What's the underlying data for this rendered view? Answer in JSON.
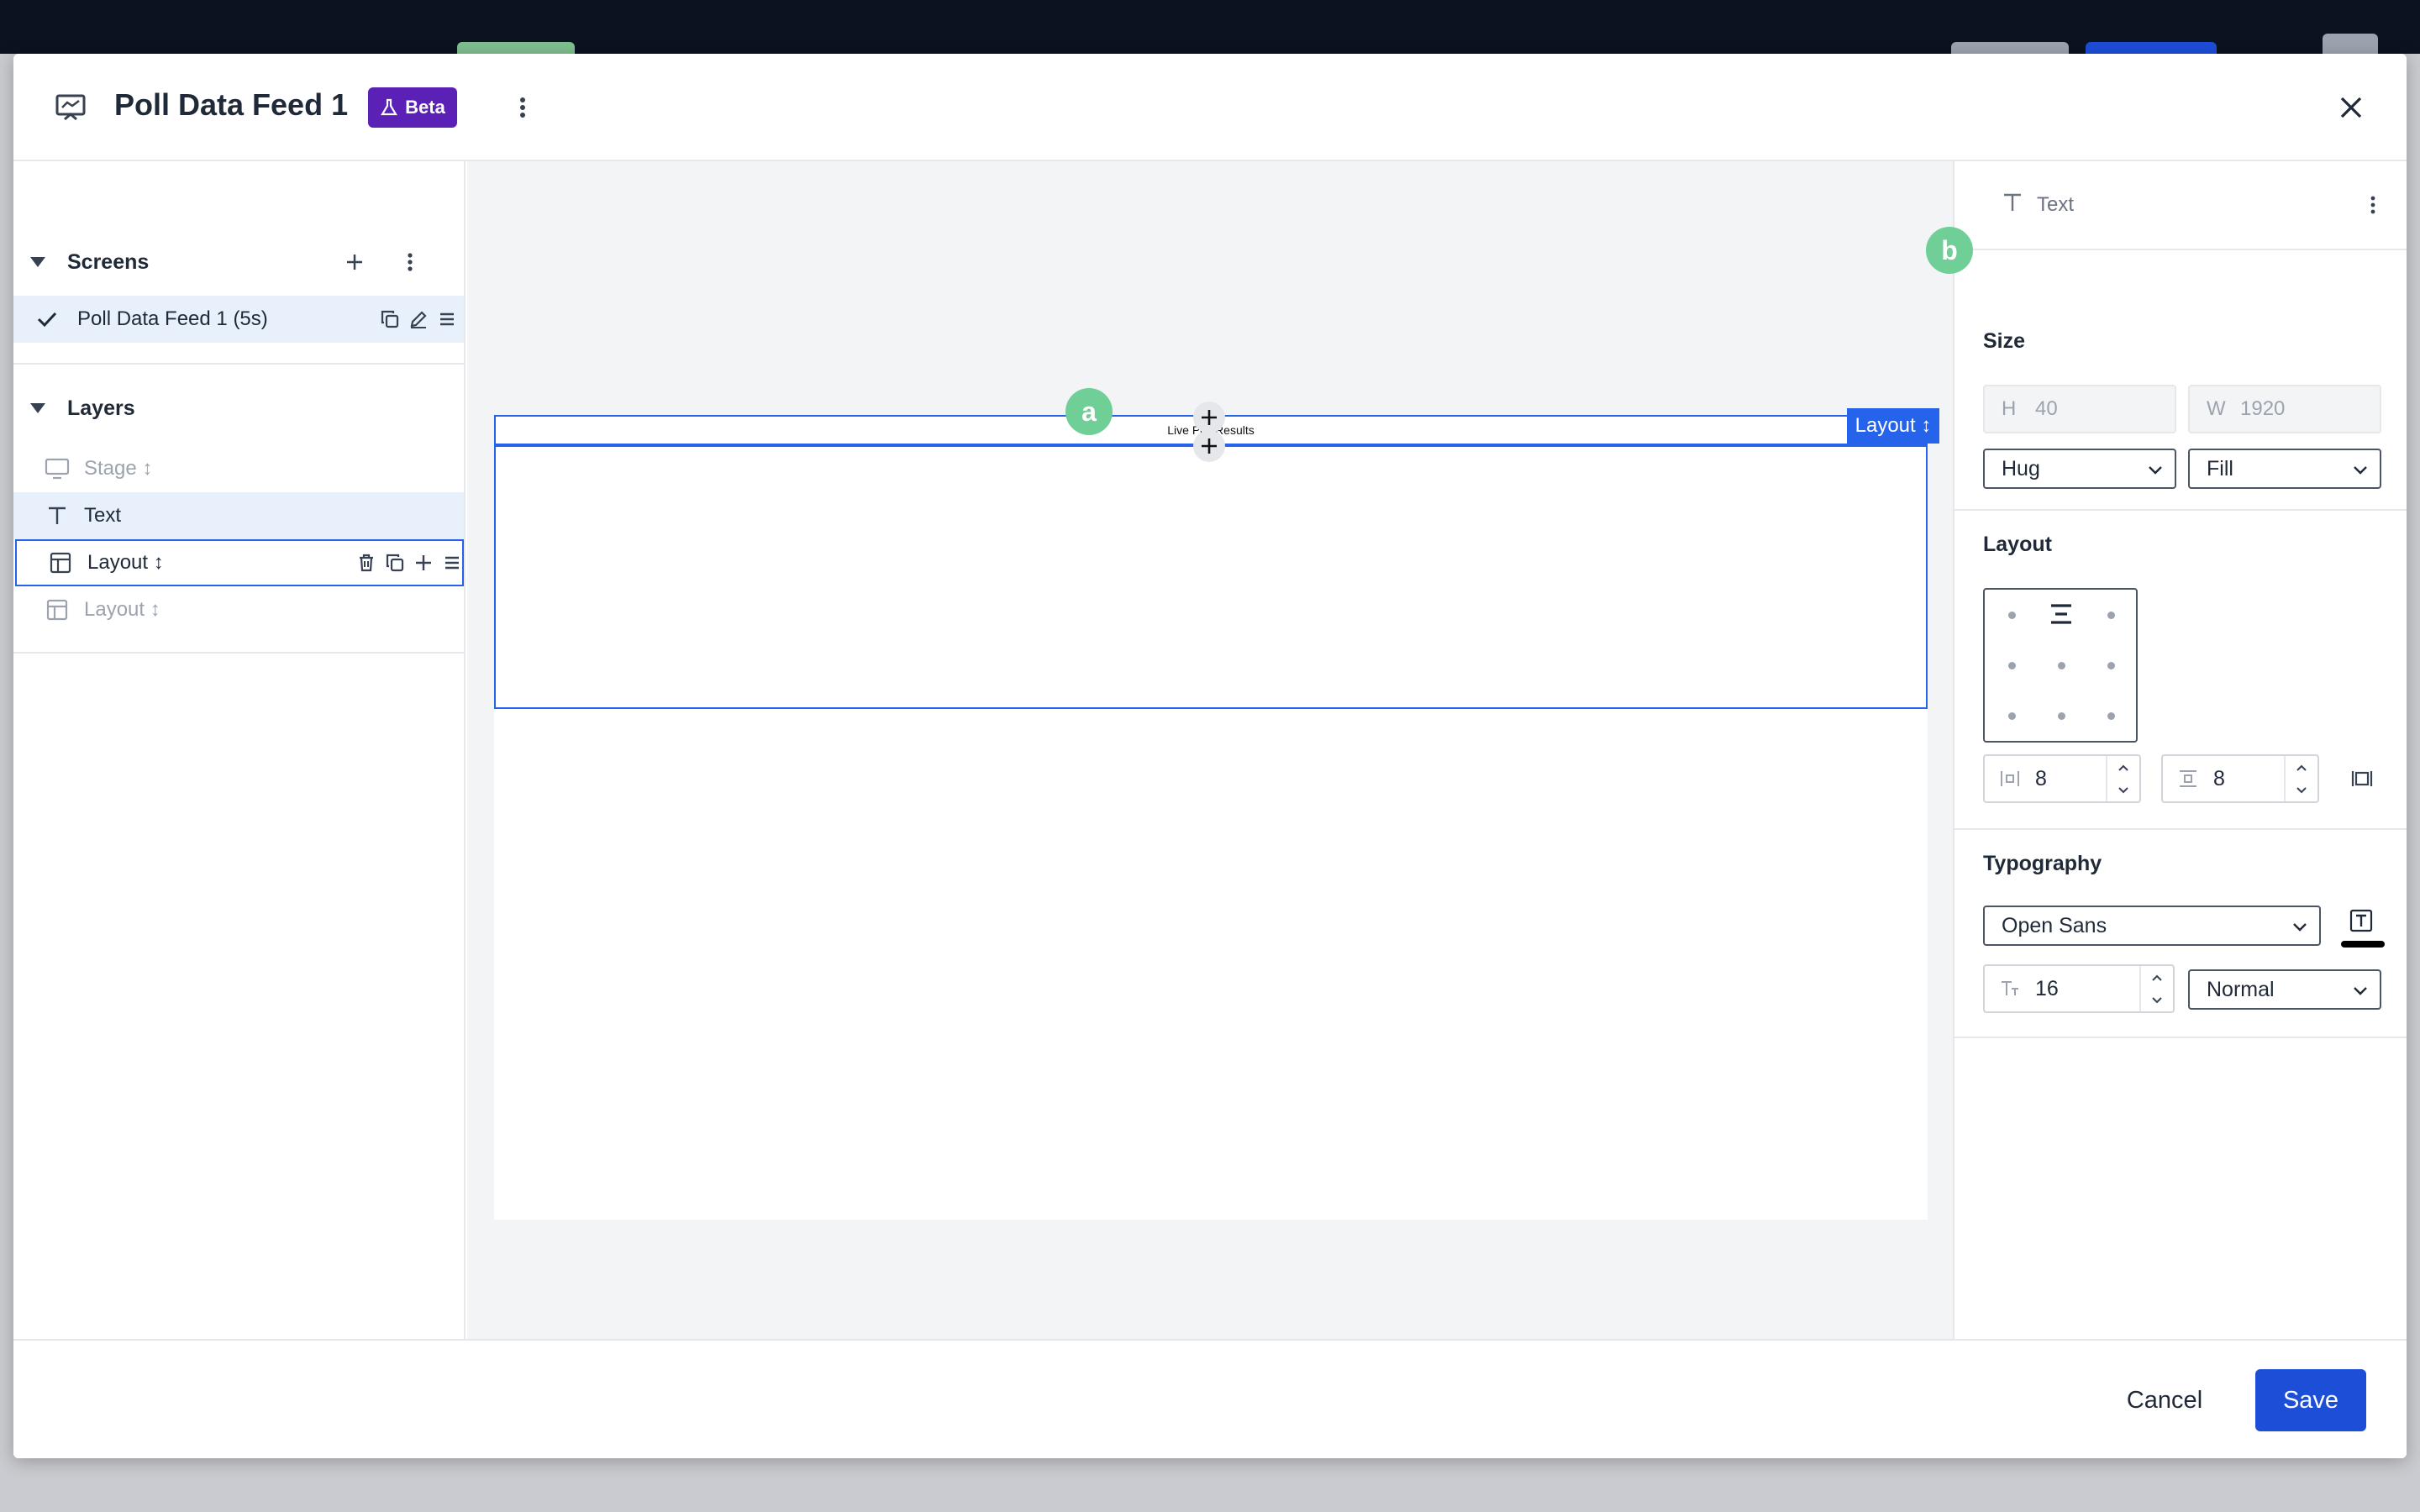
{
  "modal": {
    "title": "Poll Data Feed 1",
    "badge": "Beta"
  },
  "screens": {
    "heading": "Screens",
    "items": [
      {
        "label": "Poll Data Feed 1 (5s)"
      }
    ]
  },
  "layers": {
    "heading": "Layers",
    "items": [
      {
        "label": "Stage ↕",
        "icon": "monitor-icon"
      },
      {
        "label": "Text",
        "icon": "text-icon"
      },
      {
        "label": "Layout ↕",
        "icon": "layout-icon"
      },
      {
        "label": "Layout ↕",
        "icon": "layout-icon"
      }
    ]
  },
  "canvas": {
    "text_content": "Live Poll Results",
    "selection_tag": "Layout ↕",
    "markers": [
      "a",
      "b"
    ]
  },
  "inspector": {
    "element_type": "Text",
    "size": {
      "heading": "Size",
      "height_prefix": "H",
      "height_value": "40",
      "width_prefix": "W",
      "width_value": "1920",
      "height_mode": "Hug",
      "width_mode": "Fill"
    },
    "layout": {
      "heading": "Layout",
      "gap_horizontal": "8",
      "gap_vertical": "8"
    },
    "typography": {
      "heading": "Typography",
      "font": "Open Sans",
      "font_size": "16",
      "weight": "Normal",
      "text_color": "#000000"
    }
  },
  "footer": {
    "cancel_label": "Cancel",
    "save_label": "Save"
  },
  "colors": {
    "accent": "#2563eb",
    "beta": "#5b21b6",
    "marker": "#6fcf97",
    "selected_row": "#e8f0fc"
  }
}
